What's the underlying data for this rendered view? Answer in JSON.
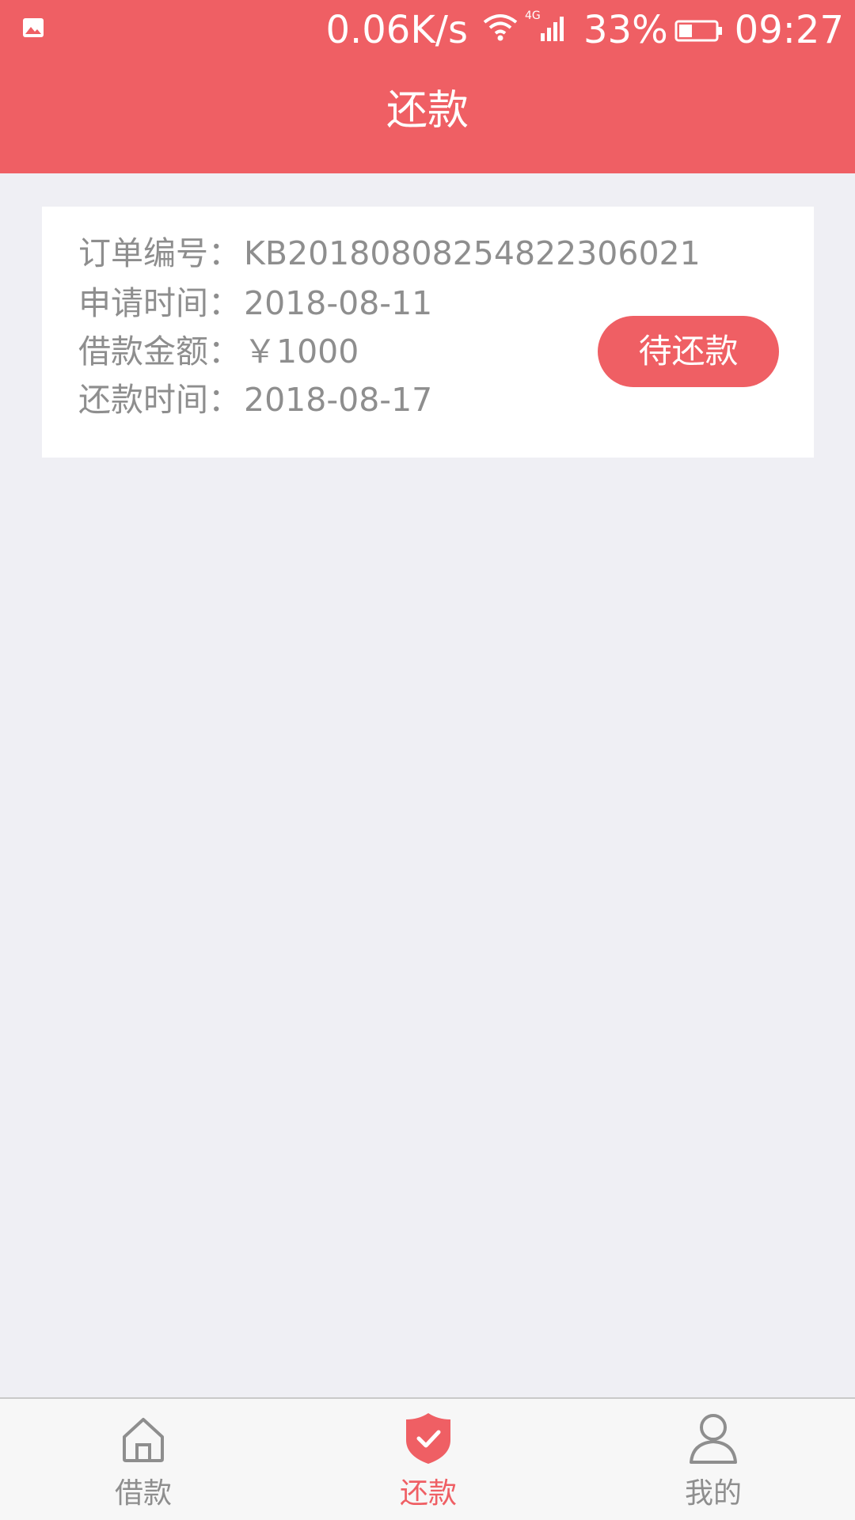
{
  "status_bar": {
    "speed": "0.06K/s",
    "network": "4G",
    "battery_percent": "33%",
    "time": "09:27",
    "icons": [
      "image-icon",
      "wifi-icon",
      "signal-icon",
      "battery-icon"
    ]
  },
  "header": {
    "title": "还款"
  },
  "order": {
    "order_no_label": "订单编号：",
    "order_no": "KB20180808254822306021",
    "apply_time_label": "申请时间：",
    "apply_time": "2018-08-11",
    "amount_label": "借款金额：",
    "amount": "￥1000",
    "repay_time_label": "还款时间：",
    "repay_time": "2018-08-17",
    "status_label": "待还款"
  },
  "tabs": [
    {
      "label": "借款",
      "icon": "home-icon",
      "active": false
    },
    {
      "label": "还款",
      "icon": "shield-check-icon",
      "active": true
    },
    {
      "label": "我的",
      "icon": "user-icon",
      "active": false
    }
  ],
  "colors": {
    "accent": "#ef5f64",
    "background": "#efeff4",
    "text_secondary": "#8e8e8e",
    "card": "#ffffff"
  }
}
